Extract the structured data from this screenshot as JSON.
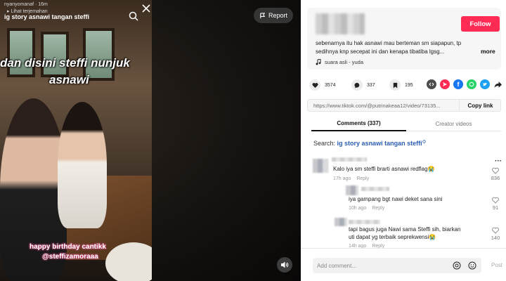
{
  "video": {
    "overlay_user": "nyanyomanaf · 16m",
    "overlay_sub": "▸ Lihat terjemahan",
    "overlay_search": "ig story asnawi tangan steffi",
    "caption_line1": "dan disini steffi nunjuk",
    "caption_line2": "asnawi",
    "bday_line1": "happy birthday cantikk",
    "bday_line2": "@steffizamoraaa",
    "report_label": "Report"
  },
  "description": {
    "text": "sebenarnya itu hak asnawi mau berteman sm siapapun, tp sedihnya knp secepat ini dan kenapa tibatiba lgsg...",
    "more_label": "more",
    "music": "suara asli - yuda"
  },
  "follow_label": "Follow",
  "stats": {
    "likes": "3574",
    "comments": "337",
    "saves": "195"
  },
  "share_colors": {
    "embed": "#4c4c4c",
    "pinterest": "#fe2c55",
    "facebook": "#1877f2",
    "whatsapp": "#25d366",
    "twitter": "#1da1f2",
    "forward": "#222222"
  },
  "link": {
    "url": "https://www.tiktok.com/@putrinakeaa12/video/73135...",
    "copy_label": "Copy link"
  },
  "tabs": {
    "comments": "Comments (337)",
    "creator": "Creator videos"
  },
  "search": {
    "prefix": "Search:",
    "query": "ig story asnawi tangan steffi"
  },
  "comments": [
    {
      "text": "Kalo iya sm steffi brarti asnawi redflag😭",
      "time": "17h ago",
      "reply": "Reply",
      "likes": "836"
    },
    {
      "text": "iya gampang bgt nawi deket sana sini",
      "time": "10h ago",
      "reply": "Reply",
      "likes": "91"
    },
    {
      "text": "tapi bagus juga Nawi sama Steffi sih, biarkan",
      "text2": "uti dapat yg terbaik seprekwensi😭",
      "time": "14h ago",
      "reply": "Reply",
      "likes": "140"
    }
  ],
  "comment_bar": {
    "placeholder": "Add comment...",
    "post_label": "Post"
  }
}
